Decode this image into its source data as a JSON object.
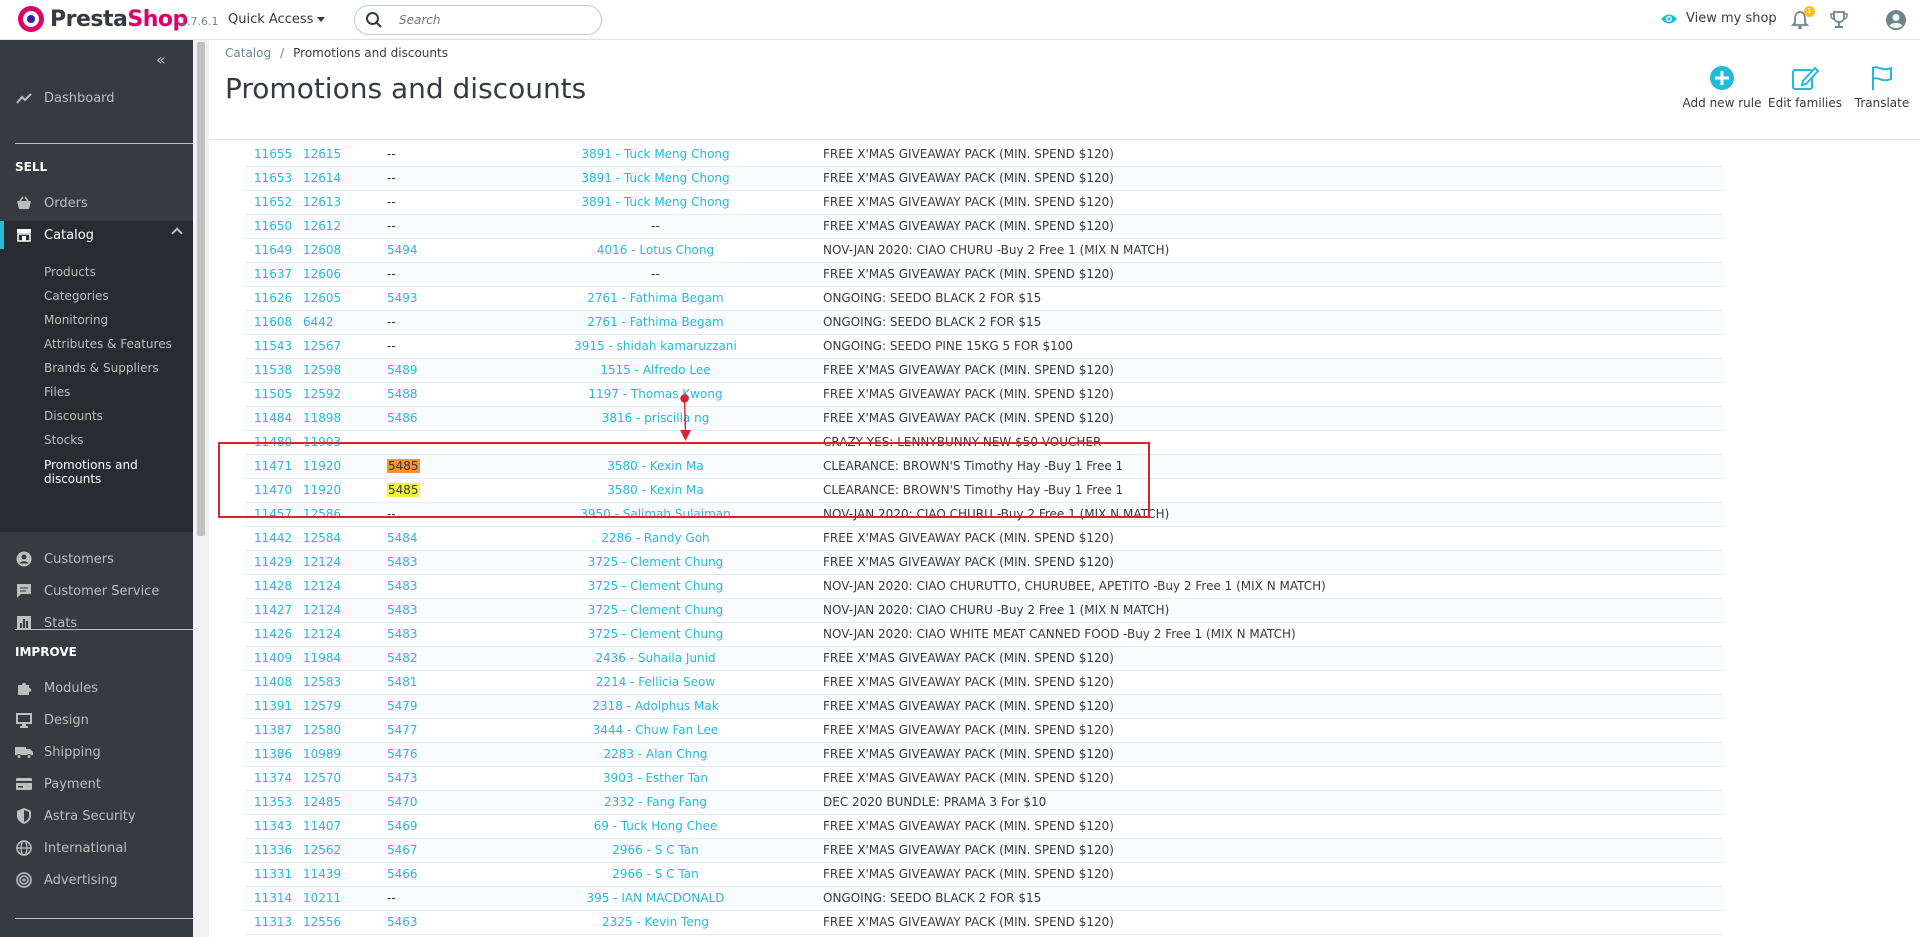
{
  "header": {
    "logo_prefix": "Presta",
    "logo_suffix": "Shop",
    "version": "1.7.6.1",
    "quick_access": "Quick Access",
    "search_placeholder": "Search",
    "view_shop": "View my shop",
    "notification_count": "1",
    "accent_color": "#25b9d7",
    "brand_color": "#df0067"
  },
  "sidebar": {
    "dashboard": "Dashboard",
    "sell_title": "SELL",
    "orders": "Orders",
    "catalog": "Catalog",
    "catalog_sub": [
      "Products",
      "Categories",
      "Monitoring",
      "Attributes & Features",
      "Brands & Suppliers",
      "Files",
      "Discounts",
      "Stocks"
    ],
    "promotions_line1": "Promotions and",
    "promotions_line2": "discounts",
    "customers": "Customers",
    "customer_service": "Customer Service",
    "stats": "Stats",
    "improve_title": "IMPROVE",
    "modules": "Modules",
    "design": "Design",
    "shipping": "Shipping",
    "payment": "Payment",
    "astra_security": "Astra Security",
    "international": "International",
    "advertising": "Advertising"
  },
  "page": {
    "breadcrumb_parent": "Catalog",
    "breadcrumb_current": "Promotions and discounts",
    "title": "Promotions and discounts",
    "add_rule": "Add new rule",
    "edit_families": "Edit families",
    "translate": "Translate"
  },
  "rows": [
    {
      "id": "11655",
      "product": "12615",
      "set": "--",
      "customer": "3891 - Tuck Meng Chong",
      "name": "FREE X'MAS GIVEAWAY PACK (MIN. SPEND $120)"
    },
    {
      "id": "11653",
      "product": "12614",
      "set": "--",
      "customer": "3891 - Tuck Meng Chong",
      "name": "FREE X'MAS GIVEAWAY PACK (MIN. SPEND $120)"
    },
    {
      "id": "11652",
      "product": "12613",
      "set": "--",
      "customer": "3891 - Tuck Meng Chong",
      "name": "FREE X'MAS GIVEAWAY PACK (MIN. SPEND $120)"
    },
    {
      "id": "11650",
      "product": "12612",
      "set": "--",
      "customer": "--",
      "name": "FREE X'MAS GIVEAWAY PACK (MIN. SPEND $120)"
    },
    {
      "id": "11649",
      "product": "12608",
      "set": "5494",
      "customer": "4016 - Lotus Chong",
      "name": "NOV-JAN 2020: CIAO CHURU -Buy 2 Free 1 (MIX N MATCH)"
    },
    {
      "id": "11637",
      "product": "12606",
      "set": "--",
      "customer": "--",
      "name": "FREE X'MAS GIVEAWAY PACK (MIN. SPEND $120)"
    },
    {
      "id": "11626",
      "product": "12605",
      "set": "5493",
      "customer": "2761 - Fathima Begam",
      "name": "ONGOING: SEEDO BLACK 2 FOR $15"
    },
    {
      "id": "11608",
      "product": "6442",
      "set": "--",
      "customer": "2761 - Fathima Begam",
      "name": "ONGOING: SEEDO BLACK 2 FOR $15"
    },
    {
      "id": "11543",
      "product": "12567",
      "set": "--",
      "customer": "3915 - shidah kamaruzzani",
      "name": "ONGOING: SEEDO PINE 15KG 5 FOR $100"
    },
    {
      "id": "11538",
      "product": "12598",
      "set": "5489",
      "customer": "1515 - Alfredo Lee",
      "name": "FREE X'MAS GIVEAWAY PACK (MIN. SPEND $120)"
    },
    {
      "id": "11505",
      "product": "12592",
      "set": "5488",
      "customer": "1197 - Thomas Kwong",
      "name": "FREE X'MAS GIVEAWAY PACK (MIN. SPEND $120)"
    },
    {
      "id": "11484",
      "product": "11898",
      "set": "5486",
      "customer": "3816 - priscilla ng",
      "name": "FREE X'MAS GIVEAWAY PACK (MIN. SPEND $120)"
    },
    {
      "id": "11480",
      "product": "11903",
      "set": "",
      "customer": "",
      "name": "CRAZY YES: LENNYBUNNY NEW $50 VOUCHER"
    },
    {
      "id": "11471",
      "product": "11920",
      "set": "5485",
      "customer": "3580 - Kexin Ma",
      "name": "CLEARANCE: BROWN'S Timothy Hay -Buy 1 Free 1",
      "hl": "orange"
    },
    {
      "id": "11470",
      "product": "11920",
      "set": "5485",
      "customer": "3580 - Kexin Ma",
      "name": "CLEARANCE: BROWN'S Timothy Hay -Buy 1 Free 1",
      "hl": "yellow"
    },
    {
      "id": "11457",
      "product": "12586",
      "set": "--",
      "customer": "3950 - Salimah Sulaiman",
      "name": "NOV-JAN 2020: CIAO CHURU -Buy 2 Free 1 (MIX N MATCH)"
    },
    {
      "id": "11442",
      "product": "12584",
      "set": "5484",
      "customer": "2286 - Randy Goh",
      "name": "FREE X'MAS GIVEAWAY PACK (MIN. SPEND $120)"
    },
    {
      "id": "11429",
      "product": "12124",
      "set": "5483",
      "customer": "3725 - Clement Chung",
      "name": "FREE X'MAS GIVEAWAY PACK (MIN. SPEND $120)"
    },
    {
      "id": "11428",
      "product": "12124",
      "set": "5483",
      "customer": "3725 - Clement Chung",
      "name": "NOV-JAN 2020: CIAO CHURUTTO, CHURUBEE, APETITO -Buy 2 Free 1 (MIX N MATCH)"
    },
    {
      "id": "11427",
      "product": "12124",
      "set": "5483",
      "customer": "3725 - Clement Chung",
      "name": "NOV-JAN 2020: CIAO CHURU -Buy 2 Free 1 (MIX N MATCH)"
    },
    {
      "id": "11426",
      "product": "12124",
      "set": "5483",
      "customer": "3725 - Clement Chung",
      "name": "NOV-JAN 2020: CIAO WHITE MEAT CANNED FOOD -Buy 2 Free 1 (MIX N MATCH)"
    },
    {
      "id": "11409",
      "product": "11984",
      "set": "5482",
      "customer": "2436 - Suhaila Junid",
      "name": "FREE X'MAS GIVEAWAY PACK (MIN. SPEND $120)"
    },
    {
      "id": "11408",
      "product": "12583",
      "set": "5481",
      "customer": "2214 - Fellicia Seow",
      "name": "FREE X'MAS GIVEAWAY PACK (MIN. SPEND $120)"
    },
    {
      "id": "11391",
      "product": "12579",
      "set": "5479",
      "customer": "2318 - Adolphus Mak",
      "name": "FREE X'MAS GIVEAWAY PACK (MIN. SPEND $120)"
    },
    {
      "id": "11387",
      "product": "12580",
      "set": "5477",
      "customer": "3444 - Chuw Fan Lee",
      "name": "FREE X'MAS GIVEAWAY PACK (MIN. SPEND $120)"
    },
    {
      "id": "11386",
      "product": "10989",
      "set": "5476",
      "customer": "2283 - Alan Chng",
      "name": "FREE X'MAS GIVEAWAY PACK (MIN. SPEND $120)"
    },
    {
      "id": "11374",
      "product": "12570",
      "set": "5473",
      "customer": "3903 - Esther Tan",
      "name": "FREE X'MAS GIVEAWAY PACK (MIN. SPEND $120)"
    },
    {
      "id": "11353",
      "product": "12485",
      "set": "5470",
      "customer": "2332 - Fang Fang",
      "name": "DEC 2020 BUNDLE: PRAMA 3 For $10"
    },
    {
      "id": "11343",
      "product": "11407",
      "set": "5469",
      "customer": "69 - Tuck Hong Chee",
      "name": "FREE X'MAS GIVEAWAY PACK (MIN. SPEND $120)"
    },
    {
      "id": "11336",
      "product": "12562",
      "set": "5467",
      "customer": "2966 - S C Tan",
      "name": "FREE X'MAS GIVEAWAY PACK (MIN. SPEND $120)"
    },
    {
      "id": "11331",
      "product": "11439",
      "set": "5466",
      "customer": "2966 - S C Tan",
      "name": "FREE X'MAS GIVEAWAY PACK (MIN. SPEND $120)"
    },
    {
      "id": "11314",
      "product": "10211",
      "set": "--",
      "customer": "395 - IAN MACDONALD",
      "name": "ONGOING: SEEDO BLACK 2 FOR $15"
    },
    {
      "id": "11313",
      "product": "12556",
      "set": "5463",
      "customer": "2325 - Kevin Teng",
      "name": "FREE X'MAS GIVEAWAY PACK (MIN. SPEND $120)"
    }
  ]
}
